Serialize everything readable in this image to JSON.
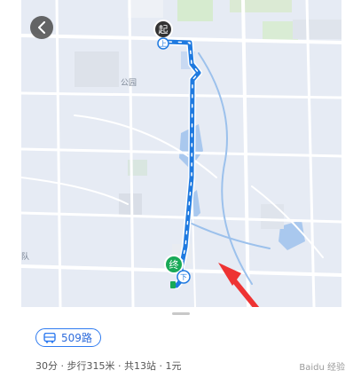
{
  "map": {
    "start_marker_label": "起",
    "start_board_label": "上",
    "end_marker_label": "终",
    "end_alight_label": "下",
    "place_label_1": "公园",
    "place_label_2": "队"
  },
  "route": {
    "line_name": "509路",
    "summary": "30分 · 步行315米 · 共13站 · 1元",
    "color": "#1f7ae0"
  },
  "watermark": "Baidu 经验"
}
